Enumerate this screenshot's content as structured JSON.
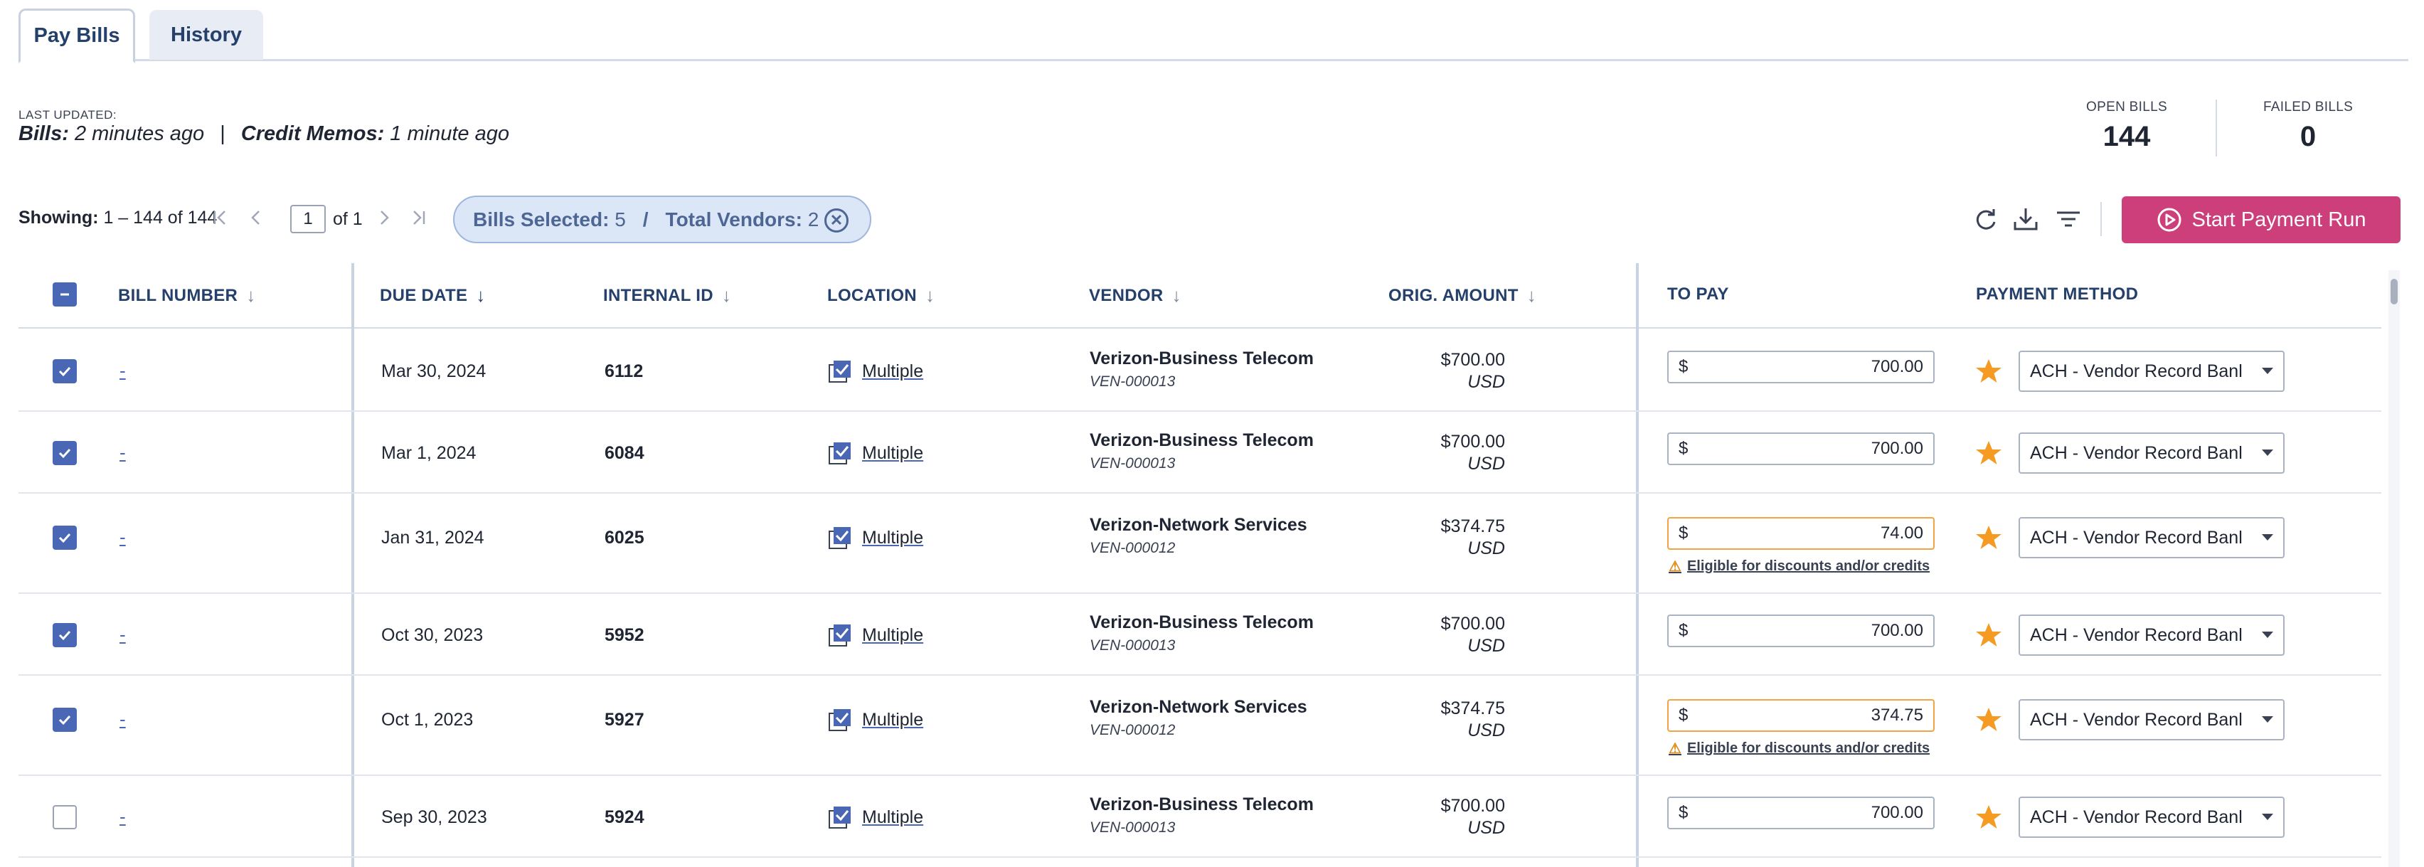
{
  "tabs": [
    {
      "label": "Pay Bills",
      "active": true
    },
    {
      "label": "History",
      "active": false
    }
  ],
  "last_updated": {
    "label": "LAST UPDATED:",
    "bills_key": "Bills:",
    "bills_value": "2 minutes ago",
    "separator": "|",
    "memos_key": "Credit Memos:",
    "memos_value": "1 minute ago"
  },
  "stats": {
    "open_bills_label": "OPEN BILLS",
    "open_bills_value": "144",
    "failed_bills_label": "FAILED BILLS",
    "failed_bills_value": "0"
  },
  "toolbar": {
    "showing_label": "Showing:",
    "showing_range": "1 – 144 of 144",
    "page_value": "1",
    "page_of": "of 1",
    "bills_selected_label": "Bills Selected:",
    "bills_selected_value": "5",
    "pill_separator": "/",
    "total_vendors_label": "Total Vendors:",
    "total_vendors_value": "2",
    "start_payment_label": "Start Payment Run",
    "icons": [
      "first-page-icon",
      "prev-page-icon",
      "next-page-icon",
      "last-page-icon",
      "refresh-icon",
      "download-icon",
      "filter-icon"
    ]
  },
  "table": {
    "headers": {
      "bill_number": "BILL NUMBER",
      "due_date": "DUE DATE",
      "internal_id": "INTERNAL ID",
      "location": "LOCATION",
      "vendor": "VENDOR",
      "orig_amount": "ORIG. AMOUNT",
      "to_pay": "TO PAY",
      "payment_method": "PAYMENT METHOD"
    },
    "rows": [
      {
        "checked": true,
        "bill": "-",
        "due": "Mar 30, 2024",
        "internal_id": "6112",
        "location": "Multiple",
        "vendor": "Verizon-Business Telecom",
        "vendor_id": "VEN-000013",
        "amount": "$700.00",
        "currency": "USD",
        "currency_symbol": "$",
        "to_pay": "700.00",
        "discount": false,
        "method": "ACH - Vendor Record Banl"
      },
      {
        "checked": true,
        "bill": "-",
        "due": "Mar 1, 2024",
        "internal_id": "6084",
        "location": "Multiple",
        "vendor": "Verizon-Business Telecom",
        "vendor_id": "VEN-000013",
        "amount": "$700.00",
        "currency": "USD",
        "currency_symbol": "$",
        "to_pay": "700.00",
        "discount": false,
        "method": "ACH - Vendor Record Banl"
      },
      {
        "checked": true,
        "bill": "-",
        "due": "Jan 31, 2024",
        "internal_id": "6025",
        "location": "Multiple",
        "vendor": "Verizon-Network Services",
        "vendor_id": "VEN-000012",
        "amount": "$374.75",
        "currency": "USD",
        "currency_symbol": "$",
        "to_pay": "74.00",
        "discount": true,
        "discount_text": "Eligible for discounts and/or credits",
        "method": "ACH - Vendor Record Banl"
      },
      {
        "checked": true,
        "bill": "-",
        "due": "Oct 30, 2023",
        "internal_id": "5952",
        "location": "Multiple",
        "vendor": "Verizon-Business Telecom",
        "vendor_id": "VEN-000013",
        "amount": "$700.00",
        "currency": "USD",
        "currency_symbol": "$",
        "to_pay": "700.00",
        "discount": false,
        "method": "ACH - Vendor Record Banl"
      },
      {
        "checked": true,
        "bill": "-",
        "due": "Oct 1, 2023",
        "internal_id": "5927",
        "location": "Multiple",
        "vendor": "Verizon-Network Services",
        "vendor_id": "VEN-000012",
        "amount": "$374.75",
        "currency": "USD",
        "currency_symbol": "$",
        "to_pay": "374.75",
        "discount": true,
        "discount_text": "Eligible for discounts and/or credits",
        "method": "ACH - Vendor Record Banl"
      },
      {
        "checked": false,
        "bill": "-",
        "due": "Sep 30, 2023",
        "internal_id": "5924",
        "location": "Multiple",
        "vendor": "Verizon-Business Telecom",
        "vendor_id": "VEN-000013",
        "amount": "$700.00",
        "currency": "USD",
        "currency_symbol": "$",
        "to_pay": "700.00",
        "discount": false,
        "method": "ACH - Vendor Record Banl"
      }
    ]
  },
  "colors": {
    "accent": "#4a67b6",
    "primary_button": "#cc3f7a",
    "star": "#f59a23",
    "warning_border": "#f0a445",
    "heading": "#24406b"
  }
}
